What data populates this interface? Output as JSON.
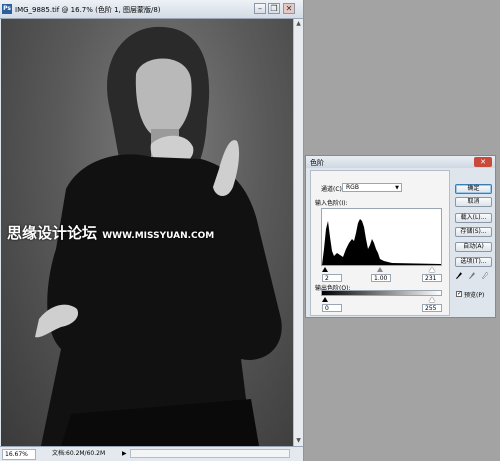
{
  "document": {
    "title": "IMG_9885.tif @ 16.7% (色阶 1, 图层蒙版/8)",
    "app_icon": "Ps",
    "controls": {
      "minimize": "–",
      "restore": "❐",
      "close": "✕"
    },
    "zoom": "16.67%",
    "doc_size": "文档:60.2M/60.2M",
    "status_arrow": "▶"
  },
  "watermark": {
    "chinese": "思缘设计论坛",
    "url": "WWW.MISSYUAN.COM"
  },
  "levels_dialog": {
    "title": "色阶",
    "close_icon": "✕",
    "channel_label": "通道(C):",
    "channel_value": "RGB",
    "input_levels_label": "输入色阶(I):",
    "input_black": "2",
    "input_gamma": "1.00",
    "input_white": "231",
    "output_levels_label": "输出色阶(O):",
    "output_black": "0",
    "output_white": "255",
    "buttons": {
      "ok": "确定",
      "cancel": "取消",
      "load": "载入(L)...",
      "save": "存储(S)...",
      "auto": "自动(A)",
      "options": "选项(T)..."
    },
    "eyedroppers": [
      "black-eyedropper-icon",
      "gray-eyedropper-icon",
      "white-eyedropper-icon"
    ],
    "preview_label": "预览(P)",
    "preview_checked": true,
    "check_mark": "✓"
  }
}
